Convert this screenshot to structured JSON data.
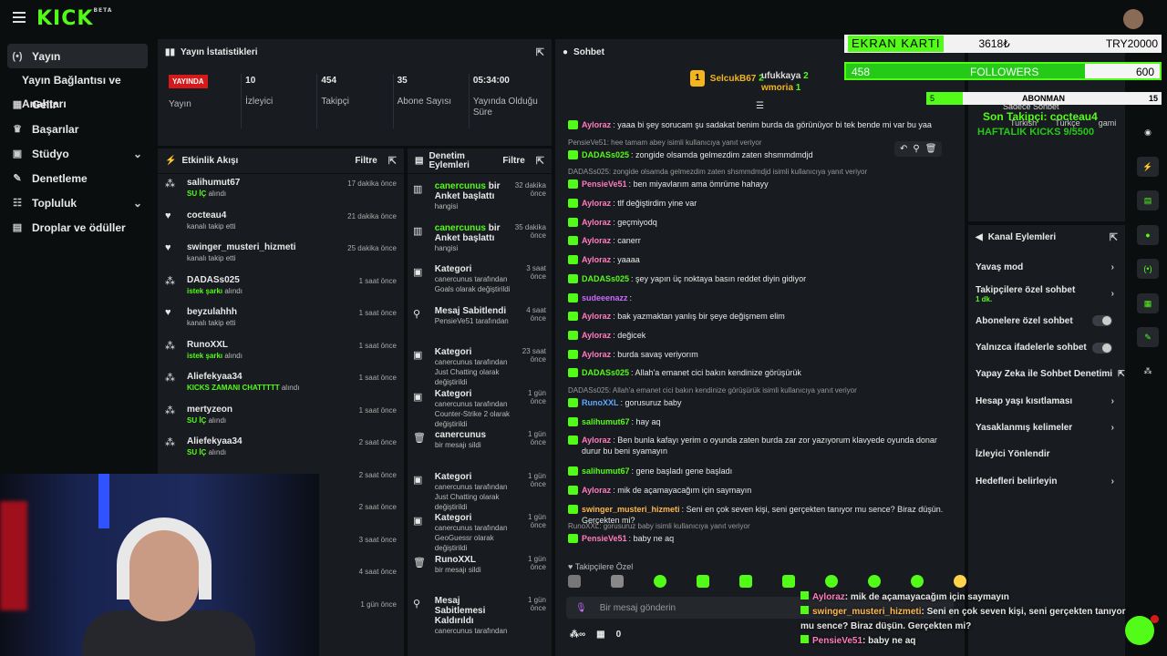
{
  "brand": {
    "logo": "KICK",
    "beta": "BETA"
  },
  "sidebar": {
    "items": [
      {
        "icon": "broadcast-icon",
        "label": "Yayın"
      },
      {
        "icon": "",
        "label": "Yayın Bağlantısı ve Anahtarı"
      },
      {
        "icon": "dashboard-icon",
        "label": "Gelir"
      },
      {
        "icon": "trophy-icon",
        "label": "Başarılar"
      },
      {
        "icon": "studio-icon",
        "label": "Stüdyo"
      },
      {
        "icon": "wrench-icon",
        "label": "Denetleme"
      },
      {
        "icon": "community-icon",
        "label": "Topluluk"
      },
      {
        "icon": "gift-icon",
        "label": "Droplar ve ödüller"
      }
    ]
  },
  "stats_panel": {
    "title": "Yayın İstatistikleri",
    "live_badge": "YAYINDA",
    "items": [
      {
        "value": "",
        "label": "Yayın"
      },
      {
        "value": "10",
        "label": "İzleyici"
      },
      {
        "value": "454",
        "label": "Takipçi"
      },
      {
        "value": "35",
        "label": "Abone Sayısı"
      },
      {
        "value": "05:34:00",
        "label": "Yayında Olduğu Süre"
      }
    ]
  },
  "activity": {
    "title": "Etkinlik Akışı",
    "filter": "Filtre",
    "items": [
      {
        "name": "salihumut67",
        "hl": "SU İÇ",
        "rest": " alındı",
        "time": "17 dakika önce"
      },
      {
        "name": "cocteau4",
        "hl": "",
        "rest": "kanalı takip etti",
        "time": "21 dakika önce"
      },
      {
        "name": "swinger_musteri_hizmeti",
        "hl": "",
        "rest": "kanalı takip etti",
        "time": "25 dakika önce"
      },
      {
        "name": "DADASs025",
        "hl": "istek şarkı",
        "rest": " alındı",
        "time": "1 saat önce"
      },
      {
        "name": "beyzulahhh",
        "hl": "",
        "rest": "kanalı takip etti",
        "time": "1 saat önce"
      },
      {
        "name": "RunoXXL",
        "hl": "istek şarkı",
        "rest": " alındı",
        "time": "1 saat önce"
      },
      {
        "name": "Aliefekyaa34",
        "hl": "KICKS ZAMANI CHATTTTT",
        "rest": " alındı",
        "time": "1 saat önce"
      },
      {
        "name": "mertyzeon",
        "hl": "SU İÇ",
        "rest": " alındı",
        "time": "1 saat önce"
      },
      {
        "name": "Aliefekyaa34",
        "hl": "SU İÇ",
        "rest": " alındı",
        "time": "2 saat önce"
      },
      {
        "name": "",
        "hl": "",
        "rest": "",
        "time": "2 saat önce"
      },
      {
        "name": "",
        "hl": "",
        "rest": "",
        "time": "2 saat önce"
      },
      {
        "name": "",
        "hl": "",
        "rest": "",
        "time": "3 saat önce"
      },
      {
        "name": "",
        "hl": "",
        "rest": "",
        "time": "4 saat önce"
      },
      {
        "name": "",
        "hl": "",
        "rest": "",
        "time": "1 gün önce"
      }
    ]
  },
  "moderation": {
    "title": "Denetim Eylemleri",
    "filter": "Filtre",
    "items": [
      {
        "l1": "canercunus",
        "l1b": " bir Anket başlattı",
        "sub": "hangisi",
        "time": "32 dakika önce"
      },
      {
        "l1": "canercunus",
        "l1b": " bir Anket başlattı",
        "sub": "hangisi",
        "time": "35 dakika önce"
      },
      {
        "l1": "Kategori",
        "l1b": "",
        "sub": "canercunus tarafından Goals olarak değiştirildi",
        "time": "3 saat önce"
      },
      {
        "l1": "Mesaj Sabitlendi",
        "l1b": "",
        "sub": "PensieVe51 tarafından",
        "time": "4 saat önce"
      },
      {
        "l1": "Kategori",
        "l1b": "",
        "sub": "canercunus tarafından Just Chatting olarak değiştirildi",
        "time": "23 saat önce"
      },
      {
        "l1": "Kategori",
        "l1b": "",
        "sub": "canercunus tarafından Counter-Strike 2 olarak değiştirildi",
        "time": "1 gün önce"
      },
      {
        "l1": "canercunus",
        "l1b": "",
        "sub": "bir mesajı sildi",
        "time": "1 gün önce"
      },
      {
        "l1": "Kategori",
        "l1b": "",
        "sub": "canercunus tarafından Just Chatting olarak değiştirildi",
        "time": "1 gün önce"
      },
      {
        "l1": "Kategori",
        "l1b": "",
        "sub": "canercunus tarafından GeoGuessr olarak değiştirildi",
        "time": "1 gün önce"
      },
      {
        "l1": "RunoXXL",
        "l1b": "",
        "sub": "bir mesajı sildi",
        "time": "1 gün önce"
      },
      {
        "l1": "Mesaj Sabitlemesi Kaldırıldı",
        "l1b": "",
        "sub": "canercunus tarafından",
        "time": "1 gün önce"
      }
    ]
  },
  "chat": {
    "title": "Sohbet",
    "leaders": [
      {
        "rank": "1",
        "name": "SelcukB67",
        "n": "2"
      },
      {
        "name": "ufukkaya",
        "n": "2"
      },
      {
        "name": "wmoria",
        "n": "1"
      }
    ],
    "messages": [
      {
        "reply": "",
        "user": "Ayloraz",
        "color": "#ff7cbd",
        "text": "yaaa bi şey sorucam şu sadakat benim burda da görünüyor bi tek bende mi var bu yaa"
      },
      {
        "reply": "PensieVe51: hee tamam abey isimli kullanıcıya yanıt veriyor",
        "user": "DADASs025",
        "color": "#53fc18",
        "text": "zongide olsamda gelmezdim zaten shsmmdmdjd"
      },
      {
        "reply": "DADASs025: zongide olsamda gelmezdim zaten shsmmdmdjd isimli kullanıcıya yanıt veriyor",
        "user": "PensieVe51",
        "color": "#ff7cbd",
        "text": "ben miyavlarım ama ömrüme hahayy"
      },
      {
        "reply": "",
        "user": "Ayloraz",
        "color": "#ff7cbd",
        "text": "tlf değiştirdim yine var"
      },
      {
        "reply": "",
        "user": "Ayloraz",
        "color": "#ff7cbd",
        "text": "geçmiyodq"
      },
      {
        "reply": "",
        "user": "Ayloraz",
        "color": "#ff7cbd",
        "text": "canerr"
      },
      {
        "reply": "",
        "user": "Ayloraz",
        "color": "#ff7cbd",
        "text": "yaaaa"
      },
      {
        "reply": "",
        "user": "DADASs025",
        "color": "#53fc18",
        "text": "şey yapın üç noktaya basın reddet diyin gidiyor"
      },
      {
        "reply": "",
        "user": "sudeeenazz",
        "color": "#c86bff",
        "text": ""
      },
      {
        "reply": "",
        "user": "Ayloraz",
        "color": "#ff7cbd",
        "text": "bak yazmaktan yanlış bir şeye değişmem elim"
      },
      {
        "reply": "",
        "user": "Ayloraz",
        "color": "#ff7cbd",
        "text": "değicek"
      },
      {
        "reply": "",
        "user": "Ayloraz",
        "color": "#ff7cbd",
        "text": "burda savaş veriyorım"
      },
      {
        "reply": "",
        "user": "DADASs025",
        "color": "#53fc18",
        "text": "Allah'a emanet cici bakın kendinize görüşürük"
      },
      {
        "reply": "DADASs025: Allah'a emanet cici bakın kendinize görüşürük isimli kullanıcıya yanıt veriyor",
        "user": "RunoXXL",
        "color": "#5ea8ff",
        "text": "gorusuruz baby"
      },
      {
        "reply": "",
        "user": "salihumut67",
        "color": "#53fc18",
        "text": "hay aq"
      },
      {
        "reply": "",
        "user": "Ayloraz",
        "color": "#ff7cbd",
        "text": "Ben bunla kafayı yerim o oyunda zaten burda zar zor yazıyorum klavyede oyunda donar durur bu beni syamayın"
      },
      {
        "reply": "",
        "user": "salihumut67",
        "color": "#53fc18",
        "text": "gene başladı gene başladı"
      },
      {
        "reply": "",
        "user": "Ayloraz",
        "color": "#ff7cbd",
        "text": "mik de açamayacağım için saymayın"
      },
      {
        "reply": "",
        "user": "swinger_musteri_hizmeti",
        "color": "#ffb84d",
        "text": "Seni en çok seven kişi, seni gerçekten tanıyor mu sence? Biraz düşün. Gerçekten mi?"
      },
      {
        "reply": "RunoXXL: gorusuruz baby isimli kullanıcıya yanıt veriyor",
        "user": "PensieVe51",
        "color": "#ff7cbd",
        "text": "baby ne aq"
      }
    ],
    "followers_only": "Takipçilere Özel",
    "input_placeholder": "Bir mesaj gönderin",
    "bottom_count": "0"
  },
  "channel_actions": {
    "title": "Kanal Eylemleri",
    "items": [
      {
        "label": "Yavaş mod",
        "sub": "",
        "ctrl": "arrow"
      },
      {
        "label": "Takipçilere özel sohbet",
        "sub": "1 dk.",
        "ctrl": "arrow"
      },
      {
        "label": "Abonelere özel sohbet",
        "sub": "",
        "ctrl": "toggle"
      },
      {
        "label": "Yalnızca ifadelerle sohbet",
        "sub": "",
        "ctrl": "toggle"
      },
      {
        "label": "Yapay Zeka ile Sohbet Denetimi",
        "sub": "",
        "ctrl": "external"
      },
      {
        "label": "Hesap yaşı kısıtlaması",
        "sub": "",
        "ctrl": "arrow"
      },
      {
        "label": "Yasaklanmış kelimeler",
        "sub": "",
        "ctrl": "arrow"
      },
      {
        "label": "İzleyici Yönlendir",
        "sub": "",
        "ctrl": ""
      },
      {
        "label": "Hedefleri belirleyin",
        "sub": "",
        "ctrl": "arrow"
      }
    ]
  },
  "overlay": {
    "ekran_label": "EKRAN KARTI",
    "ekran_value": "3618₺",
    "ekran_goal": "TRY20000",
    "followers_label": "FOLLOWERS",
    "followers_current": "458",
    "followers_goal": "600",
    "followers_progress": 0.763,
    "abone_label": "ABONMAN",
    "abone_current": "5",
    "abone_goal": "15",
    "last_follower": "Son Takipçi: cocteau4",
    "kicks": "HAFTALIK KICKS 9/5500",
    "chat_overlay": [
      {
        "user": "Ayloraz",
        "text": ": mik de açamayacağım için saymayın"
      },
      {
        "user": "swinger_musteri_hizmeti",
        "text": ": Seni en çok seven kişi, seni gerçekten tanıyor mu sence? Biraz düşün. Gerçekten mi?"
      },
      {
        "user": "PensieVe51",
        "text": ": baby ne aq"
      }
    ],
    "sadece_sohbet": "Sadece Sohbet",
    "lang1": "Turkish",
    "lang2": "Türkçe",
    "lang3": "gami"
  },
  "colors": {
    "accent": "#53fc18",
    "live": "#d51a1a",
    "panel": "#181b1f"
  }
}
